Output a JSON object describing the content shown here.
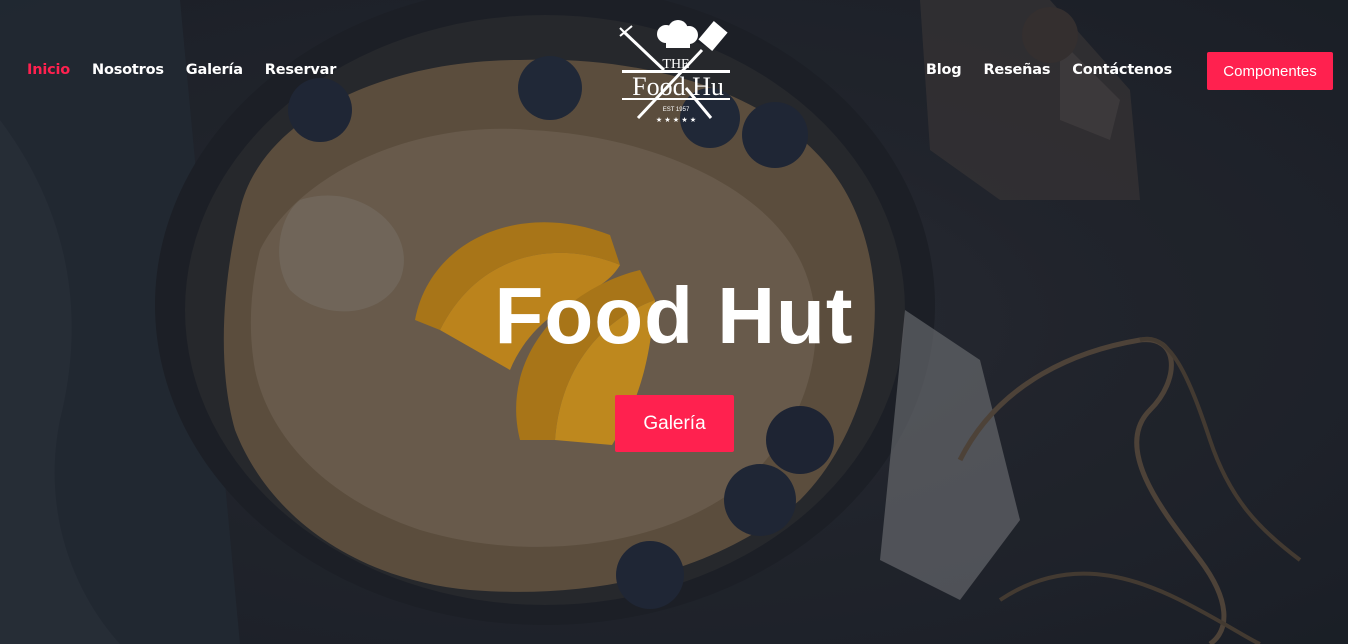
{
  "nav": {
    "left": [
      {
        "label": "Inicio",
        "active": true
      },
      {
        "label": "Nosotros",
        "active": false
      },
      {
        "label": "Galería",
        "active": false
      },
      {
        "label": "Reservar",
        "active": false
      }
    ],
    "right": [
      {
        "label": "Blog"
      },
      {
        "label": "Reseñas"
      },
      {
        "label": "Contáctenos"
      }
    ],
    "cta_label": "Componentes"
  },
  "logo": {
    "top_text": "THE",
    "name": "Food Hu",
    "est": "EST 1957",
    "stars": "★ ★ ★ ★ ★"
  },
  "hero": {
    "title": "Food Hut",
    "button_label": "Galería"
  },
  "colors": {
    "accent": "#ff214f",
    "text": "#ffffff",
    "background": "#1f242c"
  },
  "icons": [
    "chef-hat-icon",
    "fork-icon",
    "spatula-icon"
  ]
}
